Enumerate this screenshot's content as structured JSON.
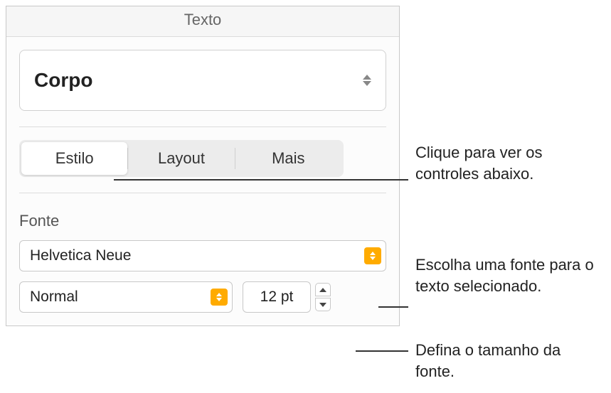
{
  "panel": {
    "title": "Texto",
    "paragraph_style": "Corpo",
    "tabs": [
      {
        "label": "Estilo",
        "active": true
      },
      {
        "label": "Layout",
        "active": false
      },
      {
        "label": "Mais",
        "active": false
      }
    ],
    "font_section_label": "Fonte",
    "font_family": "Helvetica Neue",
    "font_weight": "Normal",
    "font_size": "12 pt"
  },
  "callouts": {
    "tabs": "Clique para ver os controles abaixo.",
    "font_family": "Escolha uma fonte para o texto selecionado.",
    "font_size": "Defina o tamanho da fonte."
  }
}
